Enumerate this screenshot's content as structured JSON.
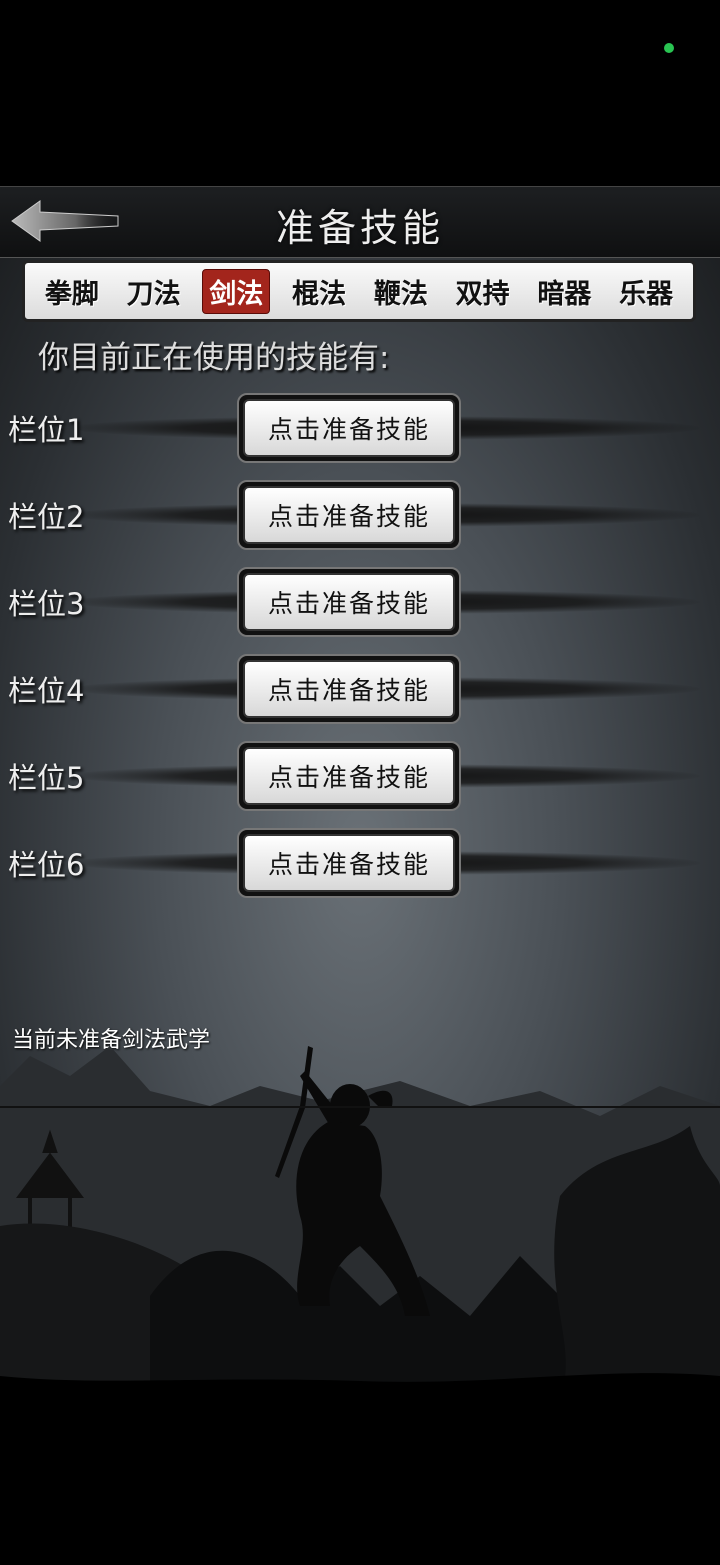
{
  "status_dot_color": "#29c452",
  "header": {
    "title": "准备技能",
    "back_icon": "back-arrow-icon"
  },
  "tabs": [
    {
      "label": "拳脚",
      "active": false
    },
    {
      "label": "刀法",
      "active": false
    },
    {
      "label": "剑法",
      "active": true
    },
    {
      "label": "棍法",
      "active": false
    },
    {
      "label": "鞭法",
      "active": false
    },
    {
      "label": "双持",
      "active": false
    },
    {
      "label": "暗器",
      "active": false
    },
    {
      "label": "乐器",
      "active": false
    }
  ],
  "current_label": "你目前正在使用的技能有:",
  "slots": [
    {
      "label": "栏位1",
      "button": "点击准备技能"
    },
    {
      "label": "栏位2",
      "button": "点击准备技能"
    },
    {
      "label": "栏位3",
      "button": "点击准备技能"
    },
    {
      "label": "栏位4",
      "button": "点击准备技能"
    },
    {
      "label": "栏位5",
      "button": "点击准备技能"
    },
    {
      "label": "栏位6",
      "button": "点击准备技能"
    }
  ],
  "status_note": "当前未准备剑法武学",
  "colors": {
    "active_tab": "#a3251c"
  }
}
